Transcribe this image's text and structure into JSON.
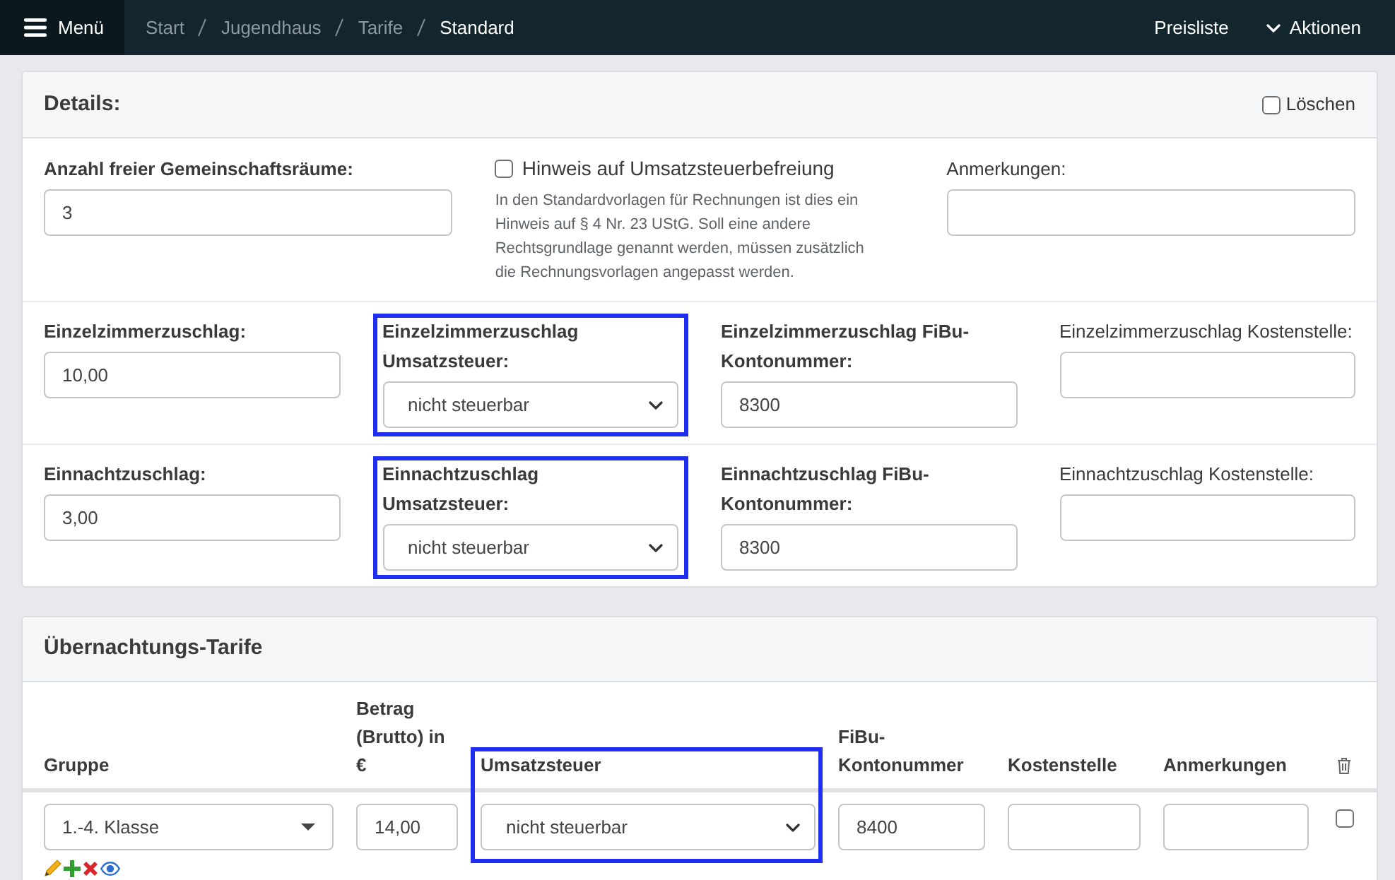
{
  "navbar": {
    "menu_button": {
      "label": "Menü"
    },
    "breadcrumb": [
      {
        "label": "Start",
        "selected": false
      },
      {
        "label": "Jugendhaus",
        "selected": false
      },
      {
        "label": "Tarife",
        "selected": false
      },
      {
        "label": "Standard",
        "selected": true
      }
    ],
    "actions": [
      {
        "kind": "button",
        "label": "Preisliste"
      },
      {
        "kind": "dropdown",
        "label": "Aktionen"
      }
    ]
  },
  "details": {
    "title": "Details:",
    "delete_checkbox": {
      "label": "Löschen",
      "checked": false
    },
    "rows": [
      {
        "fields": [
          {
            "kind": "input",
            "label": "Anzahl freier Gemeinschaftsräume:",
            "bold": true,
            "highlighted": false,
            "value": "3"
          },
          {
            "kind": "checkbox",
            "label": "Hinweis auf Umsatzsteuerbefreiung",
            "checked": false,
            "highlighted": false,
            "help": "In den Standardvorlagen für Rechnungen ist dies ein Hinweis auf § 4 Nr. 23 UStG. Soll eine andere Rechtsgrundlage genannt werden, müssen zusätzlich die Rechnungsvorlagen angepasst werden."
          },
          {
            "kind": "input",
            "label": "Anmerkungen:",
            "bold": false,
            "highlighted": false
          }
        ]
      },
      {
        "fields": [
          {
            "kind": "input",
            "label": "Einzelzimmerzuschlag:",
            "bold": true,
            "highlighted": false,
            "value": "10,00"
          },
          {
            "kind": "select",
            "label": "Einzelzimmerzuschlag Umsatzsteuer:",
            "bold": true,
            "highlighted": true,
            "value": "nicht steuerbar"
          },
          {
            "kind": "input",
            "label": "Einzelzimmerzuschlag FiBu-Kontonummer:",
            "bold": true,
            "highlighted": false,
            "value": "8300"
          },
          {
            "kind": "input",
            "label": "Einzelzimmerzuschlag Kostenstelle:",
            "bold": false,
            "highlighted": false
          }
        ]
      },
      {
        "fields": [
          {
            "kind": "input",
            "label": "Einnachtzuschlag:",
            "bold": true,
            "highlighted": false,
            "value": "3,00"
          },
          {
            "kind": "select",
            "label": "Einnachtzuschlag Umsatzsteuer:",
            "bold": true,
            "highlighted": true,
            "value": "nicht steuerbar"
          },
          {
            "kind": "input",
            "label": "Einnachtzuschlag FiBu-Kontonummer:",
            "bold": true,
            "highlighted": false,
            "value": "8300"
          },
          {
            "kind": "input",
            "label": "Einnachtzuschlag Kostenstelle:",
            "bold": false,
            "highlighted": false
          }
        ]
      }
    ]
  },
  "tariffs": {
    "title": "Übernachtungs-Tarife",
    "columns": [
      {
        "label": "Gruppe",
        "highlighted": false
      },
      {
        "label": "Betrag (Brutto) in €",
        "highlighted": false
      },
      {
        "label": "Umsatzsteuer",
        "highlighted": true
      },
      {
        "label": "FiBu-Kontonummer",
        "highlighted": false
      },
      {
        "label": "Kostenstelle",
        "highlighted": false
      },
      {
        "label": "Anmerkungen",
        "highlighted": false
      }
    ],
    "rows": [
      {
        "cells": [
          {
            "kind": "group_select",
            "value": "1.-4. Klasse"
          },
          {
            "kind": "input",
            "value": "14,00"
          },
          {
            "kind": "select",
            "value": "nicht steuerbar"
          },
          {
            "kind": "input",
            "value": "8400"
          },
          {
            "kind": "input"
          },
          {
            "kind": "input"
          }
        ],
        "delete_checked": false
      }
    ]
  }
}
